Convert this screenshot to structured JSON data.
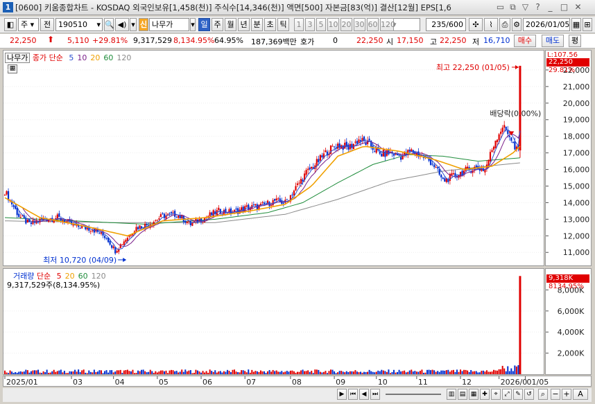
{
  "window": {
    "number": "1",
    "title": "[0600] 키움종합차트 - KOSDAQ 외국인보유[1,458(천)] 주식수[14,346(천)] 액면[500] 자본금[83(억)] 결산[12월] EPS[1,6"
  },
  "toolbar": {
    "market": "주",
    "all_label": "전",
    "code": "190510",
    "new_badge": "신",
    "stock_name": "나무가",
    "periods": [
      "일",
      "주",
      "월",
      "년",
      "분",
      "초",
      "틱"
    ],
    "active_period": "일",
    "intervals": [
      "1",
      "3",
      "5",
      "10",
      "20",
      "30",
      "60",
      "120"
    ],
    "count": "235",
    "count_total": "/600",
    "date": "2026/01/05"
  },
  "quote": {
    "price": "22,250",
    "change": "5,110",
    "change_pct": "+29.81%",
    "volume": "9,317,529",
    "volume_pct": "8,134.95%",
    "turnover_pct": "64.95%",
    "amount": "187,369백만",
    "hoga_label": "호가",
    "hoga_value": "0",
    "hoga_price": "22,250",
    "open_label": "시",
    "open": "17,150",
    "high_label": "고",
    "high": "22,250",
    "low_label": "저",
    "low": "16,710",
    "buy_button": "매수",
    "sell_button": "매도",
    "eval_button": "평"
  },
  "price_panel": {
    "legend_name": "나무가",
    "legend_ma_type": "종가 단순",
    "ma_periods": [
      "5",
      "10",
      "20",
      "60",
      "120"
    ],
    "ma_colors": [
      "#2a4fd0",
      "#7a1f8a",
      "#f0a000",
      "#1e8c3a",
      "#8a8a8a"
    ],
    "high_annotation": "최고 22,250 (01/05)",
    "low_annotation": "최저 10,720 (04/09)",
    "dividend_annotation": "배당락(0.00%)",
    "axis_top_label": "L:107.56",
    "axis_price_badge": "22,250",
    "axis_pct_badge": "29.81%"
  },
  "volume_panel": {
    "legend_name": "거래량",
    "legend_ma_type": "단순",
    "ma_periods": [
      "5",
      "20",
      "60",
      "120"
    ],
    "ma_colors": [
      "#e00000",
      "#f0a000",
      "#1e8c3a",
      "#8a8a8a"
    ],
    "summary": "9,317,529주(8,134.95%)",
    "axis_badge": "9,318K",
    "axis_pct": "8134.95%"
  },
  "colors": {
    "up": "#e00000",
    "down": "#0030d0",
    "selected": "#2d62c6"
  },
  "chart_data": {
    "type": "line",
    "y_axis_ticks": [
      "22,000",
      "21,000",
      "20,000",
      "19,000",
      "18,000",
      "17,000",
      "16,000",
      "15,000",
      "14,000",
      "13,000",
      "12,000",
      "11,000"
    ],
    "y_axis_values": [
      22000,
      21000,
      20000,
      19000,
      18000,
      17000,
      16000,
      15000,
      14000,
      13000,
      12000,
      11000
    ],
    "ylim": [
      10300,
      23000
    ],
    "volume_ticks": [
      "8,000K",
      "6,000K",
      "4,000K",
      "2,000K"
    ],
    "volume_tick_values": [
      8000,
      6000,
      4000,
      2000
    ],
    "volume_ylim": [
      0,
      9600
    ],
    "x_labels": [
      "2025/01",
      "03",
      "04",
      "05",
      "06",
      "07",
      "08",
      "09",
      "10",
      "11",
      "12",
      "2026/0",
      "01/05"
    ],
    "x_label_index": [
      0,
      38,
      62,
      87,
      112,
      137,
      163,
      188,
      212,
      235,
      260,
      282,
      297
    ],
    "price_series": [
      {
        "index": 0,
        "value": 14700
      },
      {
        "index": 8,
        "value": 13200
      },
      {
        "index": 14,
        "value": 12700
      },
      {
        "index": 22,
        "value": 13000
      },
      {
        "index": 30,
        "value": 13100
      },
      {
        "index": 40,
        "value": 12600
      },
      {
        "index": 50,
        "value": 12400
      },
      {
        "index": 58,
        "value": 11900
      },
      {
        "index": 63,
        "value": 11100
      },
      {
        "index": 68,
        "value": 11700
      },
      {
        "index": 75,
        "value": 12500
      },
      {
        "index": 82,
        "value": 12700
      },
      {
        "index": 90,
        "value": 13200
      },
      {
        "index": 98,
        "value": 13300
      },
      {
        "index": 106,
        "value": 12700
      },
      {
        "index": 114,
        "value": 13100
      },
      {
        "index": 122,
        "value": 13500
      },
      {
        "index": 130,
        "value": 13400
      },
      {
        "index": 138,
        "value": 13700
      },
      {
        "index": 146,
        "value": 13800
      },
      {
        "index": 154,
        "value": 14100
      },
      {
        "index": 160,
        "value": 14000
      },
      {
        "index": 166,
        "value": 14900
      },
      {
        "index": 172,
        "value": 15800
      },
      {
        "index": 178,
        "value": 16400
      },
      {
        "index": 184,
        "value": 17100
      },
      {
        "index": 190,
        "value": 17500
      },
      {
        "index": 196,
        "value": 17300
      },
      {
        "index": 202,
        "value": 17800
      },
      {
        "index": 208,
        "value": 17500
      },
      {
        "index": 214,
        "value": 16900
      },
      {
        "index": 220,
        "value": 17000
      },
      {
        "index": 226,
        "value": 16800
      },
      {
        "index": 232,
        "value": 17100
      },
      {
        "index": 238,
        "value": 16800
      },
      {
        "index": 244,
        "value": 16400
      },
      {
        "index": 250,
        "value": 15300
      },
      {
        "index": 256,
        "value": 15600
      },
      {
        "index": 262,
        "value": 15900
      },
      {
        "index": 268,
        "value": 16100
      },
      {
        "index": 274,
        "value": 16000
      },
      {
        "index": 280,
        "value": 17800
      },
      {
        "index": 284,
        "value": 18600
      },
      {
        "index": 288,
        "value": 18100
      },
      {
        "index": 291,
        "value": 17200
      },
      {
        "index": 293,
        "value": 17150
      },
      {
        "index": 294,
        "value": 22250
      }
    ],
    "ma20_series": [
      {
        "index": 0,
        "value": 14300
      },
      {
        "index": 20,
        "value": 13100
      },
      {
        "index": 45,
        "value": 12600
      },
      {
        "index": 70,
        "value": 12000
      },
      {
        "index": 90,
        "value": 12900
      },
      {
        "index": 115,
        "value": 13100
      },
      {
        "index": 140,
        "value": 13500
      },
      {
        "index": 160,
        "value": 13900
      },
      {
        "index": 175,
        "value": 15000
      },
      {
        "index": 190,
        "value": 16800
      },
      {
        "index": 205,
        "value": 17400
      },
      {
        "index": 225,
        "value": 17100
      },
      {
        "index": 245,
        "value": 16600
      },
      {
        "index": 262,
        "value": 16000
      },
      {
        "index": 278,
        "value": 16200
      },
      {
        "index": 290,
        "value": 17000
      },
      {
        "index": 294,
        "value": 17400
      }
    ],
    "ma60_series": [
      {
        "index": 0,
        "value": 13100
      },
      {
        "index": 40,
        "value": 12900
      },
      {
        "index": 80,
        "value": 12700
      },
      {
        "index": 120,
        "value": 13000
      },
      {
        "index": 150,
        "value": 13400
      },
      {
        "index": 170,
        "value": 14000
      },
      {
        "index": 190,
        "value": 15200
      },
      {
        "index": 210,
        "value": 16300
      },
      {
        "index": 230,
        "value": 16900
      },
      {
        "index": 250,
        "value": 16800
      },
      {
        "index": 270,
        "value": 16500
      },
      {
        "index": 294,
        "value": 16700
      }
    ],
    "ma120_series": [
      {
        "index": 0,
        "value": 12900
      },
      {
        "index": 60,
        "value": 12800
      },
      {
        "index": 120,
        "value": 12800
      },
      {
        "index": 160,
        "value": 13300
      },
      {
        "index": 190,
        "value": 14200
      },
      {
        "index": 220,
        "value": 15300
      },
      {
        "index": 250,
        "value": 15900
      },
      {
        "index": 275,
        "value": 16200
      },
      {
        "index": 294,
        "value": 16400
      }
    ],
    "volume_last": 9318,
    "volume_typical": 250
  }
}
